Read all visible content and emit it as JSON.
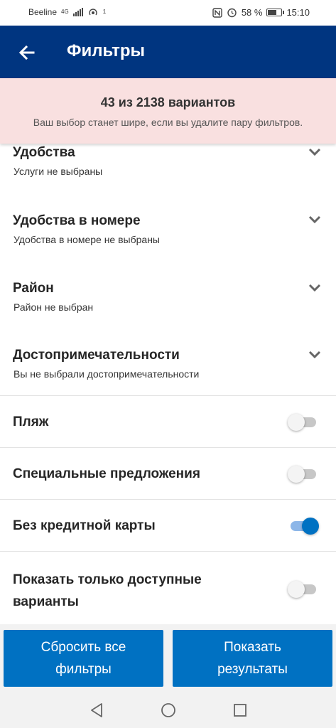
{
  "status_bar": {
    "carrier": "Beeline",
    "network": "4G",
    "sim_index": "1",
    "battery": "58 %",
    "time": "15:10"
  },
  "header": {
    "title": "Фильтры",
    "back_icon": "arrow-left-icon"
  },
  "banner": {
    "count": "43 из 2138 вариантов",
    "hint": "Ваш выбор станет шире, если вы удалите пару фильтров."
  },
  "filters": [
    {
      "title": "Удобства",
      "subtitle": "Услуги не выбраны",
      "icon": "chevron-down-icon"
    },
    {
      "title": "Удобства в номере",
      "subtitle": "Удобства в номере не выбраны",
      "icon": "chevron-down-icon"
    },
    {
      "title": "Район",
      "subtitle": "Район не выбран",
      "icon": "chevron-down-icon"
    },
    {
      "title": "Достопримечательности",
      "subtitle": "Вы не выбрали достопримечательности",
      "icon": "chevron-down-icon"
    }
  ],
  "toggles": [
    {
      "label": "Пляж",
      "on": false
    },
    {
      "label": "Специальные предложения",
      "on": false
    },
    {
      "label": "Без кредитной карты",
      "on": true
    },
    {
      "label": "Показать только доступные\nварианты",
      "on": false
    }
  ],
  "footer": {
    "reset_label": "Сбросить все\nфильтры",
    "show_label": "Показать\nрезультаты"
  },
  "colors": {
    "header": "#003580",
    "banner": "#f9e0e0",
    "button": "#0071c2",
    "toggle_on": "#0071c2",
    "toggle_off": "#c7c7c7"
  }
}
